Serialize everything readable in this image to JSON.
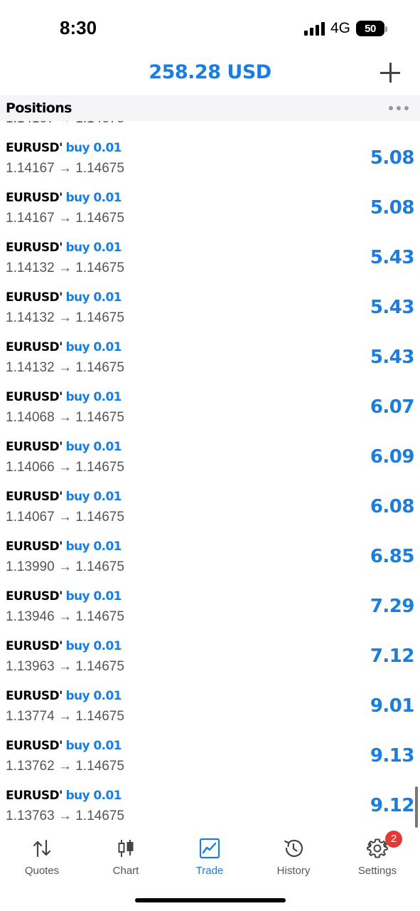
{
  "status_bar": {
    "time": "8:30",
    "network": "4G",
    "battery": "50"
  },
  "header": {
    "balance": "258.28 USD"
  },
  "section": {
    "title": "Positions"
  },
  "partial_row": {
    "prices": "1.14167 → 1.14675"
  },
  "positions": [
    {
      "symbol": "EURUSD'",
      "side": "buy 0.01",
      "prices": "1.14167 → 1.14675",
      "profit": "5.08"
    },
    {
      "symbol": "EURUSD'",
      "side": "buy 0.01",
      "prices": "1.14167 → 1.14675",
      "profit": "5.08"
    },
    {
      "symbol": "EURUSD'",
      "side": "buy 0.01",
      "prices": "1.14132 → 1.14675",
      "profit": "5.43"
    },
    {
      "symbol": "EURUSD'",
      "side": "buy 0.01",
      "prices": "1.14132 → 1.14675",
      "profit": "5.43"
    },
    {
      "symbol": "EURUSD'",
      "side": "buy 0.01",
      "prices": "1.14132 → 1.14675",
      "profit": "5.43"
    },
    {
      "symbol": "EURUSD'",
      "side": "buy 0.01",
      "prices": "1.14068 → 1.14675",
      "profit": "6.07"
    },
    {
      "symbol": "EURUSD'",
      "side": "buy 0.01",
      "prices": "1.14066 → 1.14675",
      "profit": "6.09"
    },
    {
      "symbol": "EURUSD'",
      "side": "buy 0.01",
      "prices": "1.14067 → 1.14675",
      "profit": "6.08"
    },
    {
      "symbol": "EURUSD'",
      "side": "buy 0.01",
      "prices": "1.13990 → 1.14675",
      "profit": "6.85"
    },
    {
      "symbol": "EURUSD'",
      "side": "buy 0.01",
      "prices": "1.13946 → 1.14675",
      "profit": "7.29"
    },
    {
      "symbol": "EURUSD'",
      "side": "buy 0.01",
      "prices": "1.13963 → 1.14675",
      "profit": "7.12"
    },
    {
      "symbol": "EURUSD'",
      "side": "buy 0.01",
      "prices": "1.13774 → 1.14675",
      "profit": "9.01"
    },
    {
      "symbol": "EURUSD'",
      "side": "buy 0.01",
      "prices": "1.13762 → 1.14675",
      "profit": "9.13"
    },
    {
      "symbol": "EURUSD'",
      "side": "buy 0.01",
      "prices": "1.13763 → 1.14675",
      "profit": "9.12"
    }
  ],
  "tabs": [
    {
      "label": "Quotes",
      "icon": "quotes-icon",
      "active": false
    },
    {
      "label": "Chart",
      "icon": "chart-icon",
      "active": false
    },
    {
      "label": "Trade",
      "icon": "trade-icon",
      "active": true
    },
    {
      "label": "History",
      "icon": "history-icon",
      "active": false
    },
    {
      "label": "Settings",
      "icon": "settings-icon",
      "active": false,
      "badge": "2"
    }
  ],
  "colors": {
    "accent": "#1a7de0",
    "badge": "#e53935",
    "muted_text": "#555555"
  }
}
